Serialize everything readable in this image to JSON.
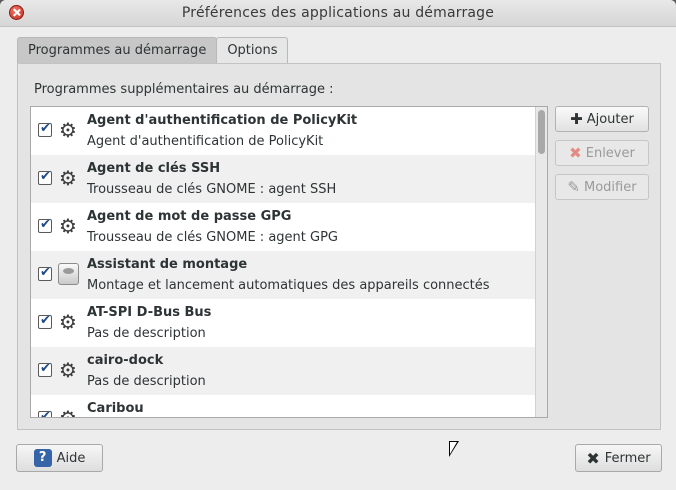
{
  "window": {
    "title": "Préférences des applications au démarrage"
  },
  "tabs": [
    {
      "label": "Programmes au démarrage",
      "active": true
    },
    {
      "label": "Options",
      "active": false
    }
  ],
  "panel": {
    "label": "Programmes supplémentaires au démarrage :"
  },
  "programs": [
    {
      "name": "Agent d'authentification de PolicyKit",
      "description": "Agent d'authentification de PolicyKit",
      "checked": true,
      "icon": "gear-icon"
    },
    {
      "name": "Agent de clés SSH",
      "description": "Trousseau de clés GNOME : agent SSH",
      "checked": true,
      "icon": "gear-icon"
    },
    {
      "name": "Agent de mot de passe GPG",
      "description": "Trousseau de clés GNOME : agent GPG",
      "checked": true,
      "icon": "gear-icon"
    },
    {
      "name": "Assistant de montage",
      "description": "Montage et lancement automatiques des appareils connectés",
      "checked": true,
      "icon": "drive-icon"
    },
    {
      "name": "AT-SPI D-Bus Bus",
      "description": "Pas de description",
      "checked": true,
      "icon": "gear-icon"
    },
    {
      "name": "cairo-dock",
      "description": "Pas de description",
      "checked": true,
      "icon": "gear-icon"
    },
    {
      "name": "Caribou",
      "description": "",
      "checked": true,
      "icon": "gear-icon"
    }
  ],
  "actions": {
    "add_label": "Ajouter",
    "remove_label": "Enlever",
    "edit_label": "Modifier"
  },
  "footer": {
    "help_label": "Aide",
    "close_label": "Fermer"
  }
}
